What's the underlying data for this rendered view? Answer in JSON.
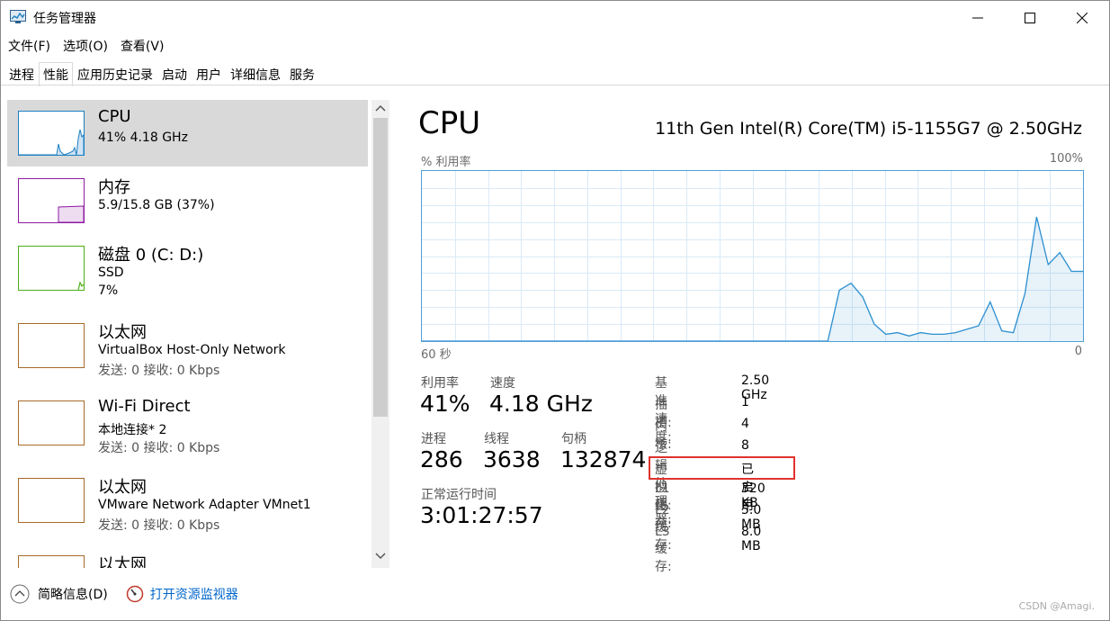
{
  "window": {
    "title": "任务管理器"
  },
  "menu": [
    {
      "label": "文件(F)"
    },
    {
      "label": "选项(O)"
    },
    {
      "label": "查看(V)"
    }
  ],
  "tabs": [
    {
      "label": "进程"
    },
    {
      "label": "性能"
    },
    {
      "label": "应用历史记录"
    },
    {
      "label": "启动"
    },
    {
      "label": "用户"
    },
    {
      "label": "详细信息"
    },
    {
      "label": "服务"
    }
  ],
  "resources": [
    {
      "title": "CPU",
      "line1": "41%  4.18 GHz",
      "line2": "",
      "color": "#1a7fc2"
    },
    {
      "title": "内存",
      "line1": "5.9/15.8 GB (37%)",
      "line2": "",
      "color": "#8e1aa3"
    },
    {
      "title": "磁盘 0 (C: D:)",
      "line1": "SSD",
      "line2": "7%",
      "color": "#4caf1a"
    },
    {
      "title": "以太网",
      "line1": "VirtualBox Host-Only Network",
      "line2": "发送: 0 接收: 0 Kbps",
      "color": "#a8692a"
    },
    {
      "title": "Wi-Fi Direct",
      "line1": "本地连接* 2",
      "line2": "发送: 0 接收: 0 Kbps",
      "color": "#a8692a"
    },
    {
      "title": "以太网",
      "line1": "VMware Network Adapter VMnet1",
      "line2": "发送: 0 接收: 0 Kbps",
      "color": "#a8692a"
    },
    {
      "title": "以太网",
      "line1": "",
      "line2": "",
      "color": "#a8692a"
    }
  ],
  "detail": {
    "title": "CPU",
    "model": "11th Gen Intel(R) Core(TM) i5-1155G7 @ 2.50GHz",
    "graph_label_left": "% 利用率",
    "graph_label_right": "100%",
    "time_left": "60 秒",
    "time_right": "0",
    "stats": {
      "util_label": "利用率",
      "util_value": "41%",
      "speed_label": "速度",
      "speed_value": "4.18 GHz",
      "proc_label": "进程",
      "proc_value": "286",
      "thread_label": "线程",
      "thread_value": "3638",
      "handle_label": "句柄",
      "handle_value": "132874",
      "uptime_label": "正常运行时间",
      "uptime_value": "3:01:27:57"
    },
    "specs": [
      {
        "label": "基准速度:",
        "value": "2.50 GHz"
      },
      {
        "label": "插槽:",
        "value": "1"
      },
      {
        "label": "内核:",
        "value": "4"
      },
      {
        "label": "逻辑处理器:",
        "value": "8"
      },
      {
        "label": "虚拟化:",
        "value": "已启用"
      },
      {
        "label": "L1 缓存:",
        "value": "320 KB"
      },
      {
        "label": "L2 缓存:",
        "value": "5.0 MB"
      },
      {
        "label": "L3 缓存:",
        "value": "8.0 MB"
      }
    ]
  },
  "footer": {
    "summary": "简略信息(D)",
    "monitor": "打开资源监视器"
  },
  "watermark": "CSDN @Amagi.",
  "chart_data": {
    "type": "area",
    "xlabel": "",
    "ylabel": "",
    "xlim": [
      60,
      0
    ],
    "ylim": [
      0,
      100
    ],
    "grid": true,
    "series": [
      {
        "values": [
          0,
          0,
          0,
          0,
          0,
          0,
          0,
          0,
          0,
          0,
          0,
          0,
          0,
          0,
          0,
          0,
          0,
          0,
          0,
          0,
          0,
          0,
          0,
          0,
          0,
          0,
          0,
          0,
          0,
          0,
          0,
          0,
          0,
          0,
          0,
          0,
          30,
          34,
          26,
          10,
          4,
          5,
          3,
          5,
          4,
          4,
          5,
          7,
          9,
          23,
          6,
          5,
          28,
          73,
          45,
          52,
          41,
          41
        ]
      }
    ]
  }
}
